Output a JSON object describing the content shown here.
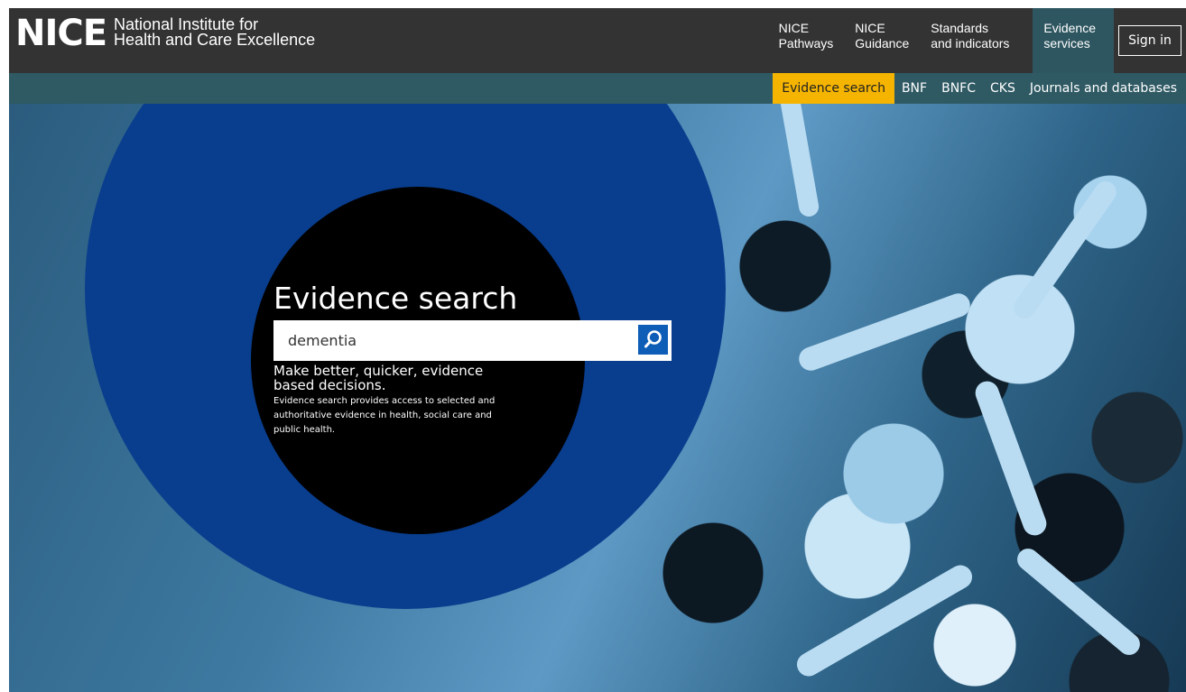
{
  "header": {
    "logo_mark": "NICE",
    "logo_line1": "National Institute for",
    "logo_line2": "Health and Care Excellence",
    "nav": [
      {
        "line1": "NICE",
        "line2": "Pathways"
      },
      {
        "line1": "NICE",
        "line2": "Guidance"
      },
      {
        "line1": "Standards",
        "line2": "and indicators"
      },
      {
        "line1": "Evidence",
        "line2": "services",
        "active": true
      }
    ],
    "sign_in": "Sign in"
  },
  "subnav": {
    "items": [
      "Evidence search",
      "BNF",
      "BNFC",
      "CKS",
      "Journals and databases"
    ],
    "active_index": 0
  },
  "hero": {
    "title": "Evidence search",
    "search_value": "dementia",
    "tagline": "Make better, quicker, evidence based decisions.",
    "description": "Evidence search provides access to selected and authoritative evidence in health, social care and public health."
  },
  "colors": {
    "header_bg": "#333333",
    "subbar_bg": "#2f5a64",
    "active_tab": "#2e5660",
    "active_subnav": "#f4b400",
    "outer_circle": "#093d8e",
    "search_button": "#0e5eb8"
  },
  "icons": {
    "search_button": "search-icon"
  }
}
